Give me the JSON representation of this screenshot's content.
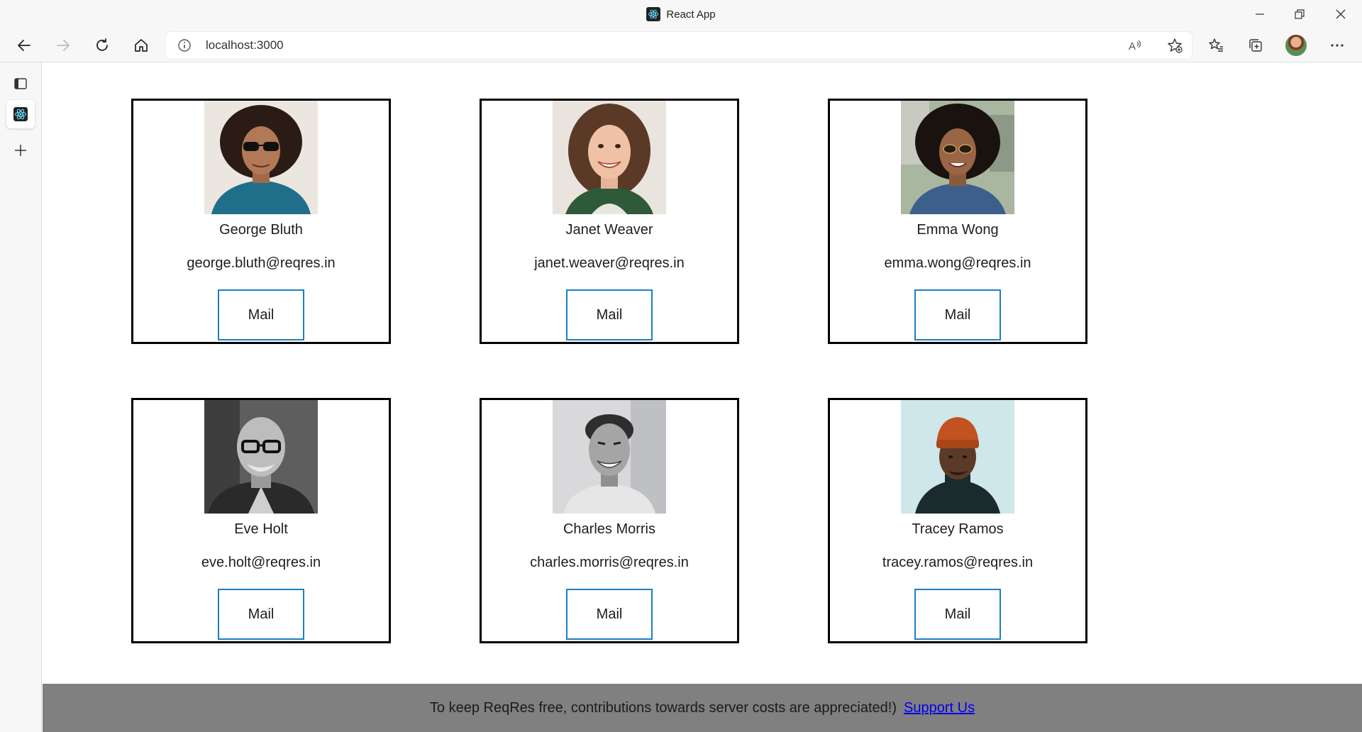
{
  "window": {
    "title": "React App"
  },
  "toolbar": {
    "url": "localhost:3000"
  },
  "users": [
    {
      "name": "George Bluth",
      "email": "george.bluth@reqres.in",
      "mail_label": "Mail"
    },
    {
      "name": "Janet Weaver",
      "email": "janet.weaver@reqres.in",
      "mail_label": "Mail"
    },
    {
      "name": "Emma Wong",
      "email": "emma.wong@reqres.in",
      "mail_label": "Mail"
    },
    {
      "name": "Eve Holt",
      "email": "eve.holt@reqres.in",
      "mail_label": "Mail"
    },
    {
      "name": "Charles Morris",
      "email": "charles.morris@reqres.in",
      "mail_label": "Mail"
    },
    {
      "name": "Tracey Ramos",
      "email": "tracey.ramos@reqres.in",
      "mail_label": "Mail"
    }
  ],
  "footer": {
    "text": "To keep ReqRes free, contributions towards server costs are appreciated!)",
    "link_label": "Support Us"
  },
  "colors": {
    "card_border": "#000000",
    "button_border": "#1e7fc1",
    "footer_bg": "#808080",
    "link": "#0000ee"
  }
}
